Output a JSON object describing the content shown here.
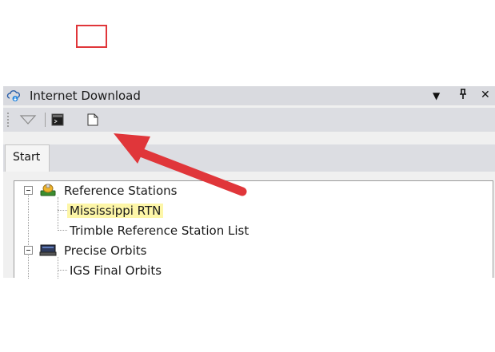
{
  "panel": {
    "title": "Internet Download",
    "title_icon": "cloud-download-icon",
    "buttons": {
      "dropdown": "▾",
      "pin": "ᴾ",
      "close": "✕"
    }
  },
  "toolbar": {
    "tools": [
      "dropdown-arrow-icon",
      "terminal-icon",
      "new-document-icon"
    ],
    "highlight_color": "#e0363a"
  },
  "tabs": [
    {
      "label": "Start"
    }
  ],
  "tree": {
    "nodes": [
      {
        "label": "Reference Stations",
        "icon": "reference-stations-icon",
        "expanded": true,
        "children": [
          {
            "label": "Mississippi RTN",
            "selected": true
          },
          {
            "label": "Trimble Reference Station List"
          }
        ]
      },
      {
        "label": "Precise Orbits",
        "icon": "precise-orbits-icon",
        "expanded": true,
        "children": [
          {
            "label": "IGS Final Orbits"
          }
        ]
      }
    ]
  },
  "annotation": {
    "arrow_color": "#e0363a"
  }
}
